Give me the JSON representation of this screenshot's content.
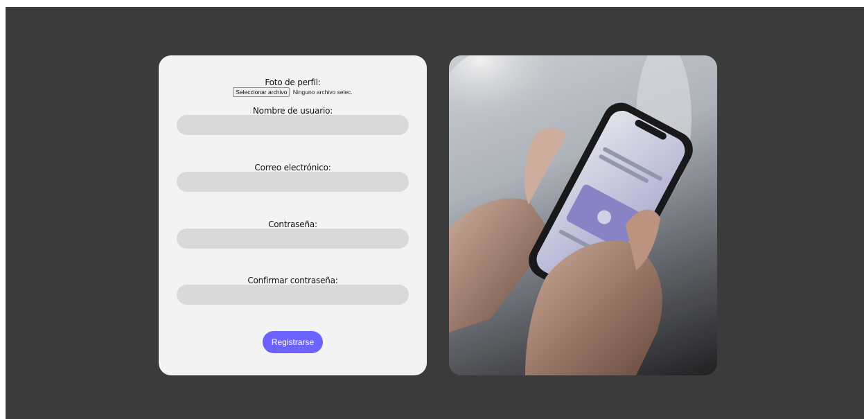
{
  "form": {
    "profile_photo_label": "Foto de perfil:",
    "file_button_label": "Seleccionar archivo",
    "file_status": "Ninguno archivo selec.",
    "username_label": "Nombre de usuario:",
    "email_label": "Correo electrónico:",
    "password_label": "Contraseña:",
    "confirm_password_label": "Confirmar contraseña:",
    "submit_label": "Registrarse"
  },
  "colors": {
    "background": "#3b3b3b",
    "card": "#f3f3f3",
    "input": "#d9d9d9",
    "accent": "#6c63ff"
  }
}
